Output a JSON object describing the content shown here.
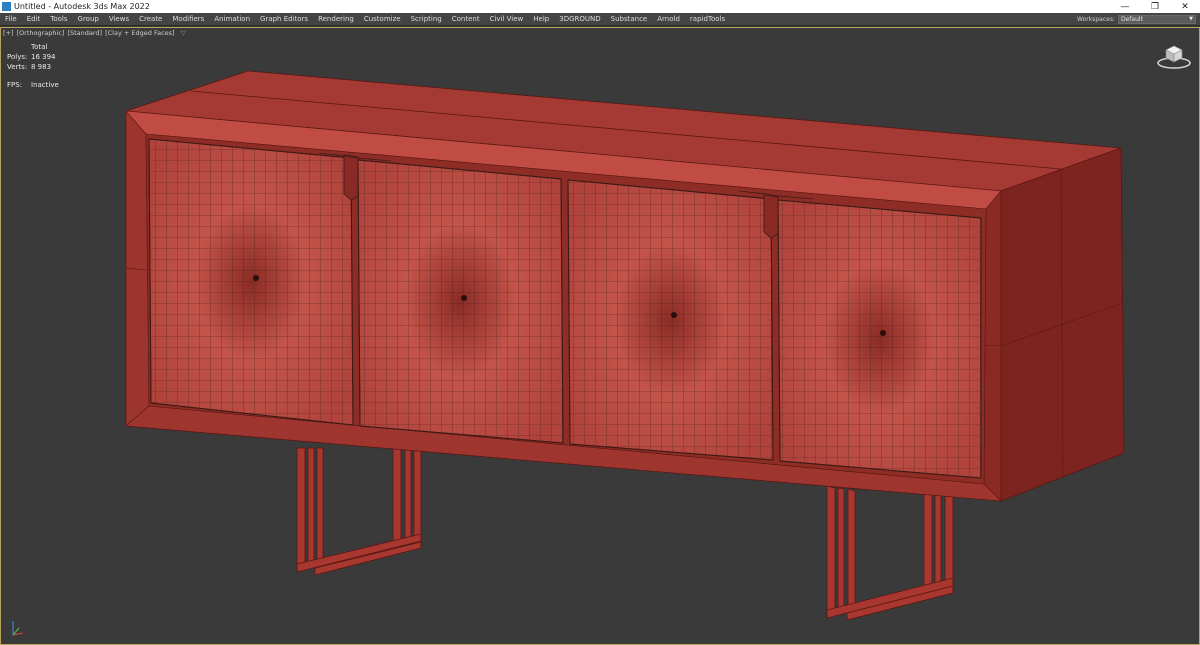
{
  "window": {
    "title": "Untitled - Autodesk 3ds Max 2022",
    "minimize_glyph": "—",
    "restore_glyph": "❐",
    "close_glyph": "✕"
  },
  "menu": {
    "items": [
      "File",
      "Edit",
      "Tools",
      "Group",
      "Views",
      "Create",
      "Modifiers",
      "Animation",
      "Graph Editors",
      "Rendering",
      "Customize",
      "Scripting",
      "Content",
      "Civil View",
      "Help",
      "3DGROUND",
      "Substance",
      "Arnold",
      "rapidTools"
    ],
    "workspaces_label": "Workspaces:",
    "workspaces_value": "Default"
  },
  "viewport": {
    "labels": [
      "[+]",
      "[Orthographic]",
      "[Standard]",
      "[Clay + Edged Faces]"
    ],
    "stats": {
      "header": "Total",
      "polys_label": "Polys:",
      "polys_value": "16 394",
      "verts_label": "Verts:",
      "verts_value": "8 983",
      "fps_label": "FPS:",
      "fps_value": "Inactive"
    }
  },
  "model": {
    "object": "sideboard-cabinet",
    "door_count": 4,
    "colors": {
      "clay_front": "#b5433b",
      "clay_top": "#a43a33",
      "clay_side": "#7e2420",
      "clay_dark": "#6a1c18",
      "wire": "#3a1a16",
      "background": "#3a3a3a"
    }
  },
  "icons": {
    "viewcube": "viewcube-icon",
    "axis": "axis-tripod-icon",
    "filter": "filter-icon",
    "app": "3dsmax-app-icon"
  }
}
